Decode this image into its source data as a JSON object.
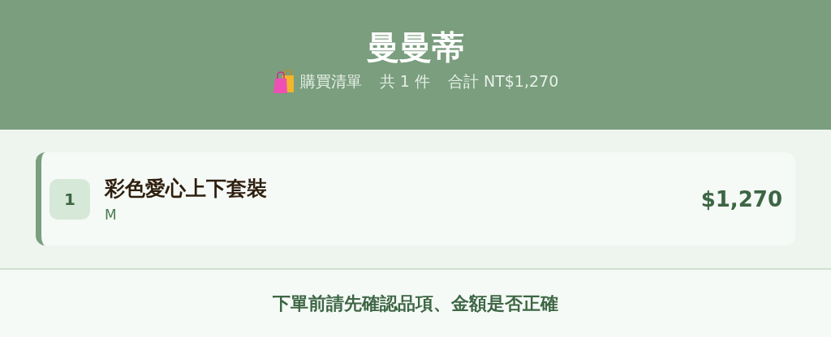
{
  "header": {
    "title": "曼曼蒂",
    "list_label": "購買清單",
    "count": "共 1 件",
    "total": "合計 NT$1,270"
  },
  "items": [
    {
      "index": "1",
      "name": "彩色愛心上下套裝",
      "variant": "M",
      "price": "$1,270"
    }
  ],
  "footer": {
    "notice": "下單前請先確認品項、金額是否正確"
  }
}
